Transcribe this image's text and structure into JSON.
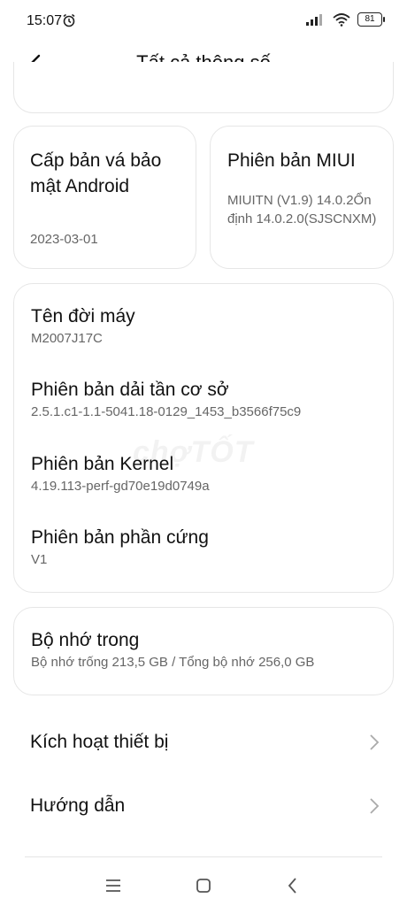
{
  "status_bar": {
    "time": "15:07",
    "battery": "81"
  },
  "header": {
    "title": "Tất cả thông số"
  },
  "security_patch": {
    "title": "Cấp bản vá bảo mật Android",
    "value": "2023-03-01"
  },
  "miui_version": {
    "title": "Phiên bản MIUI",
    "value": "MIUITN (V1.9) 14.0.2Ổn định 14.0.2.0(SJSCNXM)"
  },
  "specs": [
    {
      "label": "Tên đời máy",
      "value": "M2007J17C"
    },
    {
      "label": "Phiên bản dải tần cơ sở",
      "value": "2.5.1.c1-1.1-5041.18-0129_1453_b3566f75c9"
    },
    {
      "label": "Phiên bản Kernel",
      "value": "4.19.113-perf-gd70e19d0749a"
    },
    {
      "label": "Phiên bản phần cứng",
      "value": "V1"
    }
  ],
  "storage": {
    "label": "Bộ nhớ trong",
    "value": "Bộ nhớ trống  213,5 GB / Tổng bộ nhớ  256,0 GB"
  },
  "links": [
    {
      "label": "Kích hoạt thiết bị"
    },
    {
      "label": "Hướng dẫn"
    }
  ],
  "watermark": "chợTỐT",
  "icons": {
    "back": "arrow-left-icon",
    "alarm": "alarm-clock-icon",
    "signal": "signal-icon",
    "wifi": "wifi-icon",
    "chevron": "chevron-right-icon",
    "menu": "menu-icon",
    "home": "home-square-icon",
    "nav_back": "back-chevron-icon"
  }
}
